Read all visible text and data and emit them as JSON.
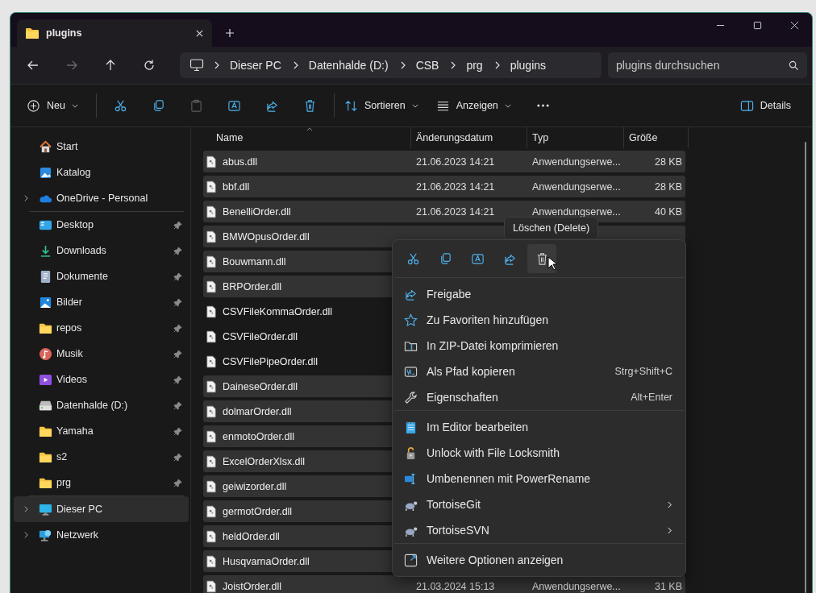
{
  "tab": {
    "title": "plugins",
    "selected": true
  },
  "address": {
    "crumbs": [
      "Dieser PC",
      "Datenhalde (D:)",
      "CSB",
      "prg",
      "plugins"
    ]
  },
  "search": {
    "placeholder": "plugins durchsuchen"
  },
  "nav": [
    {
      "kind": "back",
      "disabled": false
    },
    {
      "kind": "forward",
      "disabled": true
    },
    {
      "kind": "up",
      "disabled": false
    },
    {
      "kind": "refresh",
      "disabled": false
    }
  ],
  "toolbar": [
    {
      "kind": "new",
      "label": "Neu",
      "disabled": false
    },
    {
      "kind": "sep"
    },
    {
      "kind": "cut",
      "disabled": false
    },
    {
      "kind": "copy",
      "disabled": false
    },
    {
      "kind": "paste",
      "disabled": true
    },
    {
      "kind": "rename",
      "disabled": false
    },
    {
      "kind": "share",
      "disabled": false
    },
    {
      "kind": "delete",
      "disabled": false
    },
    {
      "kind": "sep"
    },
    {
      "kind": "sort",
      "label": "Sortieren",
      "disabled": false
    },
    {
      "kind": "view",
      "label": "Anzeigen",
      "disabled": false
    },
    {
      "kind": "more",
      "disabled": false
    }
  ],
  "details_button": {
    "label": "Details"
  },
  "sidebar": {
    "groups": [
      [
        {
          "kind": "home",
          "label": "Start",
          "expandable": false,
          "pinned": false,
          "selected": false
        },
        {
          "kind": "gallery",
          "label": "Katalog",
          "expandable": false,
          "pinned": false,
          "selected": false
        },
        {
          "kind": "cloud",
          "label": "OneDrive - Personal",
          "expandable": true,
          "pinned": false,
          "selected": false
        }
      ],
      [
        {
          "kind": "desktop",
          "label": "Desktop",
          "expandable": false,
          "pinned": true,
          "selected": false
        },
        {
          "kind": "downloads",
          "label": "Downloads",
          "expandable": false,
          "pinned": true,
          "selected": false
        },
        {
          "kind": "documents",
          "label": "Dokumente",
          "expandable": false,
          "pinned": true,
          "selected": false
        },
        {
          "kind": "pictures",
          "label": "Bilder",
          "expandable": false,
          "pinned": true,
          "selected": false
        },
        {
          "kind": "folder",
          "label": "repos",
          "expandable": false,
          "pinned": true,
          "selected": false
        },
        {
          "kind": "music",
          "label": "Musik",
          "expandable": false,
          "pinned": true,
          "selected": false
        },
        {
          "kind": "videos",
          "label": "Videos",
          "expandable": false,
          "pinned": true,
          "selected": false
        },
        {
          "kind": "drive",
          "label": "Datenhalde (D:)",
          "expandable": false,
          "pinned": true,
          "selected": false
        },
        {
          "kind": "folder",
          "label": "Yamaha",
          "expandable": false,
          "pinned": true,
          "selected": false
        },
        {
          "kind": "folder",
          "label": "s2",
          "expandable": false,
          "pinned": true,
          "selected": false
        },
        {
          "kind": "folder",
          "label": "prg",
          "expandable": false,
          "pinned": true,
          "selected": false
        }
      ],
      [
        {
          "kind": "pc",
          "label": "Dieser PC",
          "expandable": true,
          "pinned": false,
          "selected": true
        },
        {
          "kind": "network",
          "label": "Netzwerk",
          "expandable": true,
          "pinned": false,
          "selected": false
        }
      ]
    ]
  },
  "table": {
    "columns": [
      "Name",
      "Änderungsdatum",
      "Typ",
      "Größe"
    ],
    "rows": [
      {
        "name": "abus.dll",
        "date": "21.06.2023 14:21",
        "type": "Anwendungserwe...",
        "size": "28 KB",
        "selected": true
      },
      {
        "name": "bbf.dll",
        "date": "21.06.2023 14:21",
        "type": "Anwendungserwe...",
        "size": "28 KB",
        "selected": true
      },
      {
        "name": "BenelliOrder.dll",
        "date": "21.06.2023 14:21",
        "type": "Anwendungserwe...",
        "size": "40 KB",
        "selected": true
      },
      {
        "name": "BMWOpusOrder.dll",
        "selected": true
      },
      {
        "name": "Bouwmann.dll",
        "selected": true
      },
      {
        "name": "BRPOrder.dll",
        "selected": true
      },
      {
        "name": "CSVFileKommaOrder.dll",
        "selected": false
      },
      {
        "name": "CSVFileOrder.dll",
        "selected": false
      },
      {
        "name": "CSVFilePipeOrder.dll",
        "selected": false
      },
      {
        "name": "DaineseOrder.dll",
        "selected": true
      },
      {
        "name": "dolmarOrder.dll",
        "selected": true
      },
      {
        "name": "enmotoOrder.dll",
        "selected": true
      },
      {
        "name": "ExcelOrderXlsx.dll",
        "selected": true
      },
      {
        "name": "geiwizorder.dll",
        "selected": true
      },
      {
        "name": "germotOrder.dll",
        "selected": true
      },
      {
        "name": "heldOrder.dll",
        "selected": true
      },
      {
        "name": "HusqvarnaOrder.dll",
        "selected": true
      },
      {
        "name": "JoistOrder.dll",
        "date": "21.03.2024 15:13",
        "type": "Anwendungserwe...",
        "size": "31 KB",
        "selected": true
      }
    ]
  },
  "tooltip": {
    "text": "Löschen (Delete)"
  },
  "context_menu": {
    "quick_actions": [
      {
        "kind": "cut",
        "hovered": false
      },
      {
        "kind": "copy",
        "hovered": false
      },
      {
        "kind": "rename",
        "hovered": false
      },
      {
        "kind": "share",
        "hovered": false
      },
      {
        "kind": "delete",
        "hovered": true
      }
    ],
    "groups": [
      [
        {
          "kind": "share",
          "label": "Freigabe",
          "submenu": false
        },
        {
          "kind": "star",
          "label": "Zu Favoriten hinzufügen",
          "submenu": false
        },
        {
          "kind": "zip",
          "label": "In ZIP-Datei komprimieren",
          "submenu": false
        },
        {
          "kind": "path",
          "label": "Als Pfad kopieren",
          "shortcut": "Strg+Shift+C",
          "submenu": false
        },
        {
          "kind": "wrench",
          "label": "Eigenschaften",
          "shortcut": "Alt+Enter",
          "submenu": false
        }
      ],
      [
        {
          "kind": "notepad",
          "label": "Im Editor bearbeiten",
          "submenu": false
        },
        {
          "kind": "lock",
          "label": "Unlock with File Locksmith",
          "submenu": false
        },
        {
          "kind": "powerrename",
          "label": "Umbenennen mit PowerRename",
          "submenu": false
        },
        {
          "kind": "turtle",
          "label": "TortoiseGit",
          "submenu": true
        },
        {
          "kind": "turtle",
          "label": "TortoiseSVN",
          "submenu": true
        }
      ],
      [
        {
          "kind": "more",
          "label": "Weitere Optionen anzeigen",
          "submenu": false
        }
      ]
    ]
  }
}
